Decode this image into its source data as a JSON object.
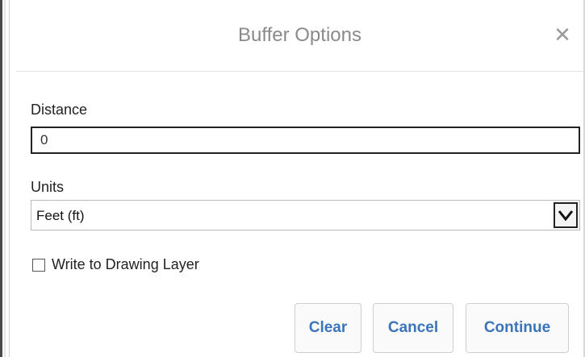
{
  "dialog": {
    "title": "Buffer Options",
    "close_icon": "close-icon",
    "distance": {
      "label": "Distance",
      "value": "0"
    },
    "units": {
      "label": "Units",
      "selected": "Feet (ft)",
      "arrow_icon": "chevron-down-icon"
    },
    "write_to_layer": {
      "label": "Write to Drawing Layer",
      "checked": false
    },
    "buttons": {
      "clear": "Clear",
      "cancel": "Cancel",
      "continue": "Continue"
    }
  },
  "colors": {
    "title_text": "#8a8a8a",
    "button_text": "#3b74b8",
    "border_dark": "#222222"
  }
}
